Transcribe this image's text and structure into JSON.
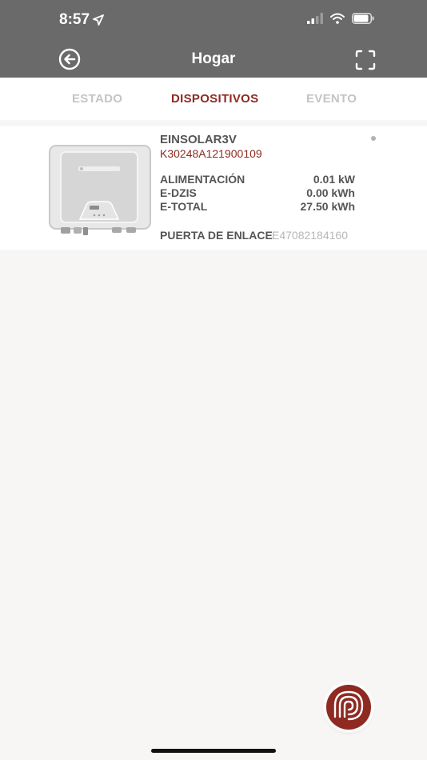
{
  "status_bar": {
    "time": "8:57"
  },
  "header": {
    "title": "Hogar"
  },
  "tabs": [
    {
      "label": "ESTADO",
      "active": false
    },
    {
      "label": "DISPOSITIVOS",
      "active": true
    },
    {
      "label": "EVENTO",
      "active": false
    }
  ],
  "device": {
    "name": "EINSOLAR3V",
    "serial": "K30248A121900109",
    "rows": [
      {
        "label": "ALIMENTACIÓN",
        "value": "0.01 kW"
      },
      {
        "label": "E-DZIS",
        "value": "0.00 kWh"
      },
      {
        "label": "E-TOTAL",
        "value": "27.50 kWh"
      }
    ],
    "gateway_label": "PUERTA DE ENLACE",
    "gateway_value": "E47082184160",
    "image_logo": "EINS ELECTRIC"
  },
  "colors": {
    "header_bg": "#6a6a6a",
    "accent": "#8e2a22",
    "tab_inactive": "#c4c4c4",
    "page_bg": "#f7f6f5"
  },
  "icons": {
    "back": "back-arrow-circle-icon",
    "scan": "scan-frame-icon",
    "location": "location-arrow-icon",
    "fab": "signal-waves-icon"
  }
}
